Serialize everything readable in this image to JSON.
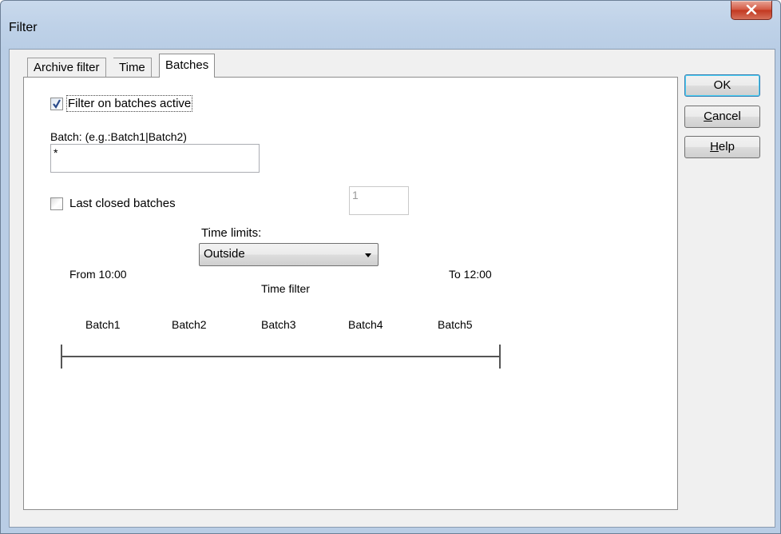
{
  "window": {
    "title": "Filter"
  },
  "tabs": [
    {
      "label": "Archive filter",
      "active": false
    },
    {
      "label": "Time",
      "active": false
    },
    {
      "label": "Batches",
      "active": true
    }
  ],
  "batches_tab": {
    "filter_active": {
      "label": "Filter on batches active",
      "checked": true
    },
    "batch_field": {
      "label": "Batch: (e.g.:Batch1|Batch2)",
      "value": "*"
    },
    "last_closed": {
      "label": "Last closed batches",
      "checked": false,
      "count_value": "1"
    },
    "time_limits": {
      "label": "Time limits:",
      "selected": "Outside"
    },
    "timeline": {
      "from_label": "From 10:00",
      "to_label": "To 12:00",
      "filter_label": "Time filter",
      "batches": [
        "Batch1",
        "Batch2",
        "Batch3",
        "Batch4",
        "Batch5"
      ]
    }
  },
  "buttons": {
    "ok": {
      "label": "OK"
    },
    "cancel": {
      "mnemonic": "C",
      "rest": "ancel"
    },
    "help": {
      "mnemonic": "H",
      "rest": "elp"
    }
  },
  "icons": {
    "close": "close-icon",
    "check": "checkmark-icon",
    "dropdown": "chevron-down-icon"
  }
}
